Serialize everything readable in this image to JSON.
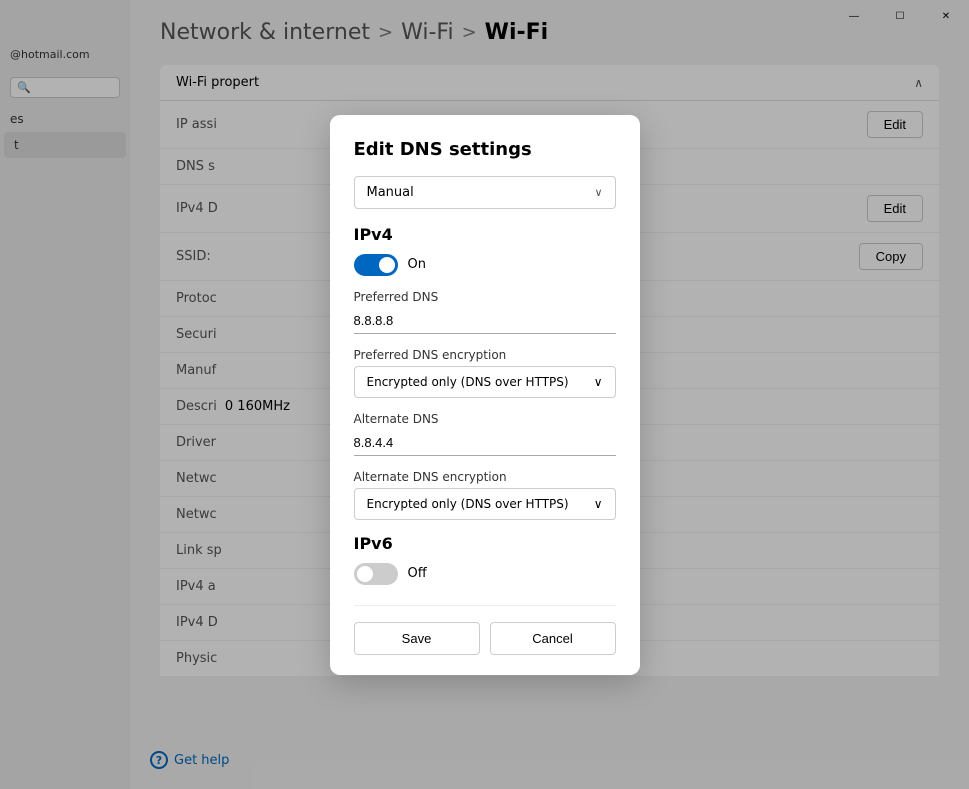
{
  "titlebar": {
    "minimize_label": "—",
    "maximize_label": "☐",
    "close_label": "✕"
  },
  "sidebar": {
    "email": "@hotmail.com",
    "search_placeholder": "🔍",
    "items": [
      {
        "label": "es",
        "active": false
      },
      {
        "label": "t",
        "active": true
      }
    ]
  },
  "breadcrumb": {
    "items": [
      {
        "label": "Network & internet"
      },
      {
        "label": "Wi-Fi"
      },
      {
        "label": "Wi-Fi",
        "current": true
      }
    ],
    "separators": [
      ">",
      ">"
    ]
  },
  "wifi_properties": {
    "section_title": "Wi-Fi propert",
    "chevron": "∧",
    "rows": [
      {
        "label": "IP assi",
        "value": "",
        "action": "Edit"
      },
      {
        "label": "DNS s",
        "value": "",
        "action": null
      },
      {
        "label": "IPv4 D",
        "value": "",
        "action": "Edit"
      },
      {
        "label": "SSID:",
        "value": "",
        "action": null
      },
      {
        "label": "Protoc",
        "value": "",
        "action": null
      },
      {
        "label": "Securi",
        "value": "",
        "action": null
      },
      {
        "label": "Manuf",
        "value": "",
        "action": null
      },
      {
        "label": "Descri",
        "value": "",
        "action": null
      },
      {
        "label": "Driver",
        "value": "",
        "action": null
      },
      {
        "label": "Netwc",
        "value": "",
        "action": null
      },
      {
        "label": "Netwc",
        "value": "",
        "action": null
      },
      {
        "label": "Link sp",
        "value": "",
        "action": null
      },
      {
        "label": "IPv4 a",
        "value": "",
        "action": null
      },
      {
        "label": "IPv4 D",
        "value": "",
        "action": null
      },
      {
        "label": "Physic",
        "value": "",
        "action": null
      }
    ],
    "copy_button": "Copy",
    "band_value": "0 160MHz"
  },
  "dialog": {
    "title": "Edit DNS settings",
    "mode_dropdown": {
      "value": "Manual",
      "arrow": "∨"
    },
    "ipv4": {
      "section_label": "IPv4",
      "toggle_on": true,
      "toggle_label_on": "On",
      "preferred_dns_label": "Preferred DNS",
      "preferred_dns_value": "8.8.8.8",
      "preferred_encryption_label": "Preferred DNS encryption",
      "preferred_encryption_value": "Encrypted only (DNS over HTTPS)",
      "preferred_encryption_arrow": "∨",
      "alternate_dns_label": "Alternate DNS",
      "alternate_dns_value": "8.8.4.4",
      "alternate_encryption_label": "Alternate DNS encryption",
      "alternate_encryption_value": "Encrypted only (DNS over HTTPS)",
      "alternate_encryption_arrow": "∨"
    },
    "ipv6": {
      "section_label": "IPv6",
      "toggle_on": false,
      "toggle_label_off": "Off"
    },
    "footer": {
      "save_label": "Save",
      "cancel_label": "Cancel"
    }
  },
  "help": {
    "icon": "?",
    "label": "Get help"
  }
}
